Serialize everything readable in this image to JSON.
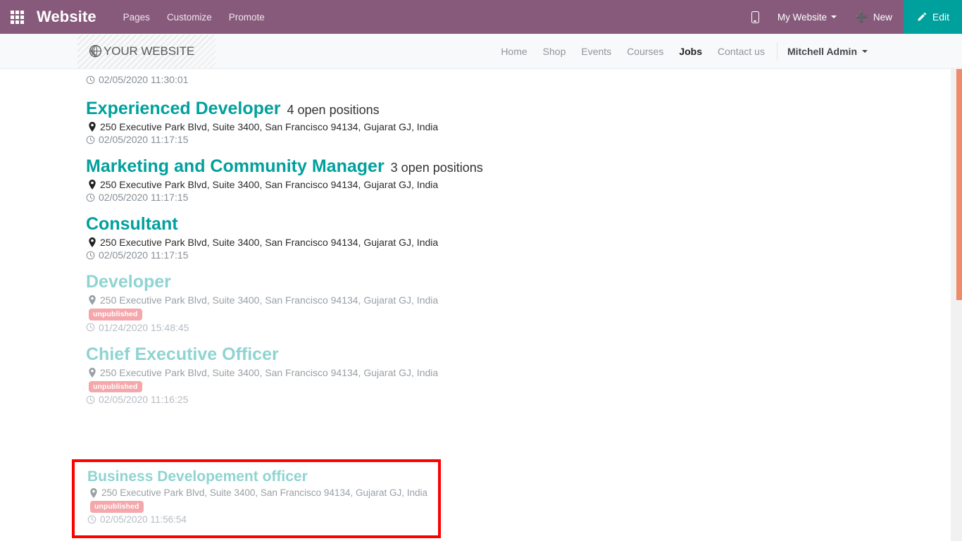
{
  "odoo_navbar": {
    "apps_icon": "apps-grid-icon",
    "brand": "Website",
    "menu": [
      {
        "label": "Pages"
      },
      {
        "label": "Customize"
      },
      {
        "label": "Promote"
      }
    ],
    "mobile_preview_icon": "mobile-phone-icon",
    "site_selector": "My Website",
    "new_label": "New",
    "new_icon": "plus-icon",
    "edit_label": "Edit",
    "edit_icon": "pencil-icon",
    "colors": {
      "bar": "#875A7B",
      "edit": "#00A09D"
    }
  },
  "site_header": {
    "logo_icon": "globe-icon",
    "logo_text": "YOUR WEBSITE",
    "nav": [
      {
        "label": "Home",
        "active": false
      },
      {
        "label": "Shop",
        "active": false
      },
      {
        "label": "Events",
        "active": false
      },
      {
        "label": "Courses",
        "active": false
      },
      {
        "label": "Jobs",
        "active": true
      },
      {
        "label": "Contact us",
        "active": false
      }
    ],
    "user": "Mitchell Admin"
  },
  "main": {
    "partial_timestamp": "02/05/2020 11:30:01",
    "address_common": "250 Executive Park Blvd, Suite 3400, San Francisco 94134, Gujarat GJ, India",
    "badge_label": "unpublished",
    "jobs": [
      {
        "title": "Experienced Developer",
        "positions": "4 open positions",
        "address": "250 Executive Park Blvd, Suite 3400, San Francisco 94134, Gujarat GJ, India",
        "timestamp": "02/05/2020 11:17:15",
        "published": true
      },
      {
        "title": "Marketing and Community Manager",
        "positions": "3 open positions",
        "address": "250 Executive Park Blvd, Suite 3400, San Francisco 94134, Gujarat GJ, India",
        "timestamp": "02/05/2020 11:17:15",
        "published": true
      },
      {
        "title": "Consultant",
        "positions": "",
        "address": "250 Executive Park Blvd, Suite 3400, San Francisco 94134, Gujarat GJ, India",
        "timestamp": "02/05/2020 11:17:15",
        "published": true
      },
      {
        "title": "Developer",
        "positions": "",
        "address": "250 Executive Park Blvd, Suite 3400, San Francisco 94134, Gujarat GJ, India",
        "timestamp": "01/24/2020 15:48:45",
        "published": false,
        "badge": "unpublished"
      },
      {
        "title": "Chief Executive Officer",
        "positions": "",
        "address": "250 Executive Park Blvd, Suite 3400, San Francisco 94134, Gujarat GJ, India",
        "timestamp": "02/05/2020 11:16:25",
        "published": false,
        "badge": "unpublished"
      }
    ],
    "highlighted_job": {
      "title": "Business Developement officer",
      "positions": "",
      "address": "250 Executive Park Blvd, Suite 3400, San Francisco 94134, Gujarat GJ, India",
      "timestamp": "02/05/2020 11:56:54",
      "published": false,
      "badge": "unpublished",
      "highlight_color": "#FF0000"
    }
  },
  "scrollbar": {
    "thumb_color": "#EE8B6A",
    "track_color": "#f1f1f1"
  }
}
